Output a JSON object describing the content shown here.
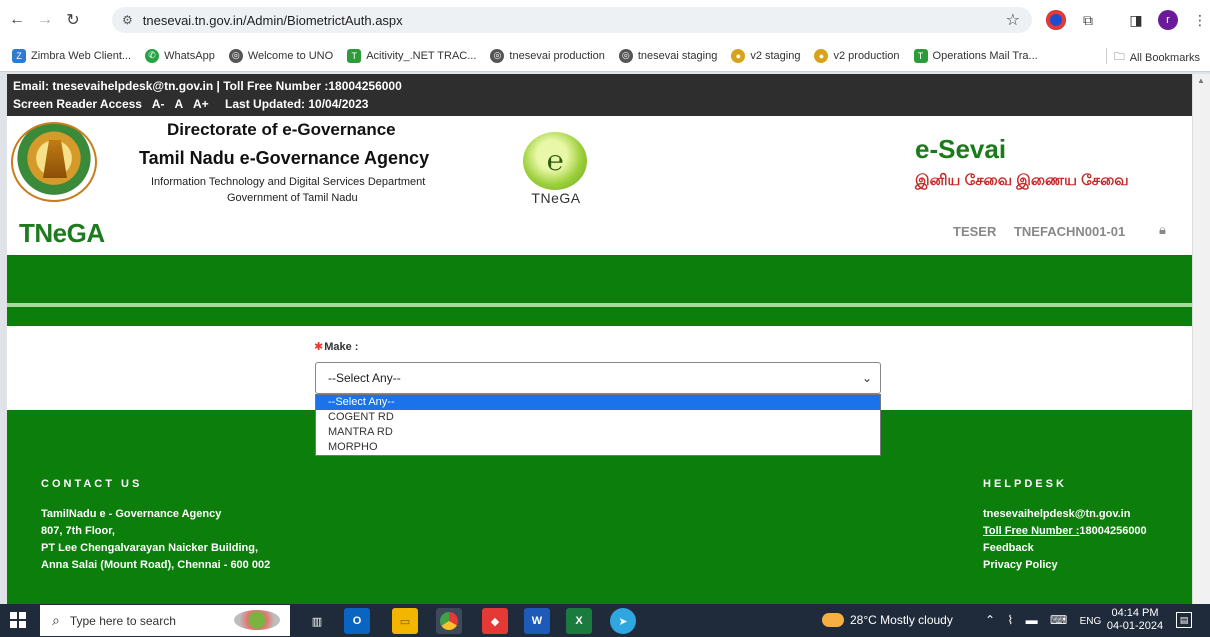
{
  "browser": {
    "url": "tnesevai.tn.gov.in/Admin/BiometrictAuth.aspx",
    "profile_initial": "r",
    "bookmarks": [
      {
        "label": "Zimbra Web Client...",
        "color": "#2e7bd1"
      },
      {
        "label": "WhatsApp",
        "color": "#25a244"
      },
      {
        "label": "Welcome to UNO",
        "color": "#555555"
      },
      {
        "label": "Acitivity_.NET TRAC...",
        "color": "#2e9b3a"
      },
      {
        "label": "tnesevai production",
        "color": "#555555"
      },
      {
        "label": "tnesevai staging",
        "color": "#555555"
      },
      {
        "label": "v2 staging",
        "color": "#d9a21b"
      },
      {
        "label": "v2 production",
        "color": "#d9a21b"
      },
      {
        "label": "Operations Mail Tra...",
        "color": "#2e9b3a"
      }
    ],
    "all_bookmarks": "All Bookmarks"
  },
  "topstrip": {
    "line1": "Email: tnesevaihelpdesk@tn.gov.in | Toll Free Number :18004256000",
    "screen_reader": "Screen Reader Access",
    "font_minus": "A-",
    "font_normal": "A",
    "font_plus": "A+",
    "last_updated": "Last Updated: 10/04/2023"
  },
  "header": {
    "directorate": "Directorate of e-Governance",
    "agency": "Tamil Nadu e-Governance Agency",
    "department": "Information Technology and Digital Services Department",
    "government": "Government of Tamil Nadu",
    "logo_text": "TNeGA",
    "esevai": "e-Sevai",
    "tamil_tagline": "இனிய சேவை இணைய சேவை",
    "brand": "TNeGA",
    "user_name": "TESER",
    "user_code": "TNEFACHN001-01"
  },
  "form": {
    "make_label": "Make :",
    "selected": "--Select Any--",
    "options": [
      "--Select Any--",
      "COGENT RD",
      "MANTRA RD",
      "MORPHO"
    ]
  },
  "footer": {
    "contact_heading": "CONTACT US",
    "contact_lines": [
      "TamilNadu e - Governance Agency",
      "807, 7th Floor,",
      "PT Lee Chengalvarayan Naicker Building,",
      "Anna Salai (Mount Road), Chennai - 600 002"
    ],
    "helpdesk_heading": "HELPDESK",
    "help_email": "tnesevaihelpdesk@tn.gov.in",
    "toll_free_label": "Toll Free Number :",
    "toll_free_number": "18004256000",
    "feedback": "Feedback",
    "privacy": "Privacy Policy"
  },
  "taskbar": {
    "search_placeholder": "Type here to search",
    "weather": "28°C  Mostly cloudy",
    "lang": "ENG",
    "time": "04:14 PM",
    "date": "04-01-2024"
  }
}
